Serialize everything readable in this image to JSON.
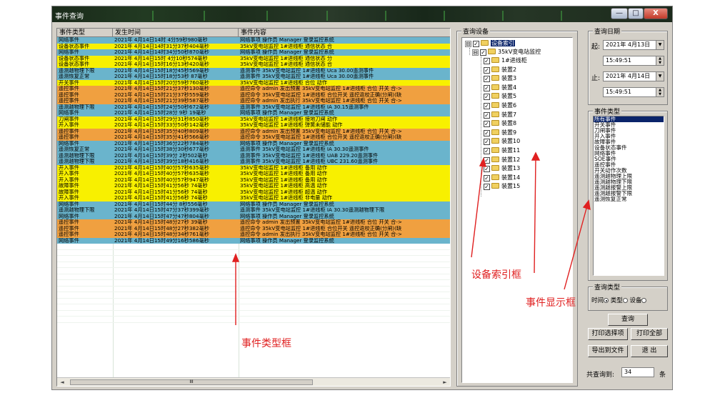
{
  "window": {
    "title": "事件查询",
    "buttons": [
      "—",
      "□",
      "X"
    ]
  },
  "table": {
    "columns": [
      "事件类型",
      "发生时间",
      "事件内容"
    ],
    "rows": [
      {
        "type": "网络事件",
        "time": "2021年 4月14日14时 4分59秒980毫秒",
        "content": "网络事项 操作员 Manager 登录监控系统",
        "color": "blue"
      },
      {
        "type": "设备状态事件",
        "time": "2021年 4月14日14时31分37秒404毫秒",
        "content": "35kV变电站监控 1#进线柜 通信状态 合",
        "color": "yellow"
      },
      {
        "type": "网络事件",
        "time": "2021年 4月14日14时34分50秒870毫秒",
        "content": "网络事项 操作员 Manager 登录监控系统",
        "color": "blue"
      },
      {
        "type": "设备状态事件",
        "time": "2021年 4月14日15时 4分10秒574毫秒",
        "content": "35kV变电站监控 1#进线柜 通信状态 分",
        "color": "yellow"
      },
      {
        "type": "设备状态事件",
        "time": "2021年 4月14日15时16分13秒420毫秒",
        "content": "35kV变电站监控 1#进线柜 通信状态 合",
        "color": "yellow"
      },
      {
        "type": "遥测越物理下限",
        "time": "2021年 4月14日15时18分45秒569毫秒",
        "content": "遥测事件 35kV变电站监控 1#进线柜 Uca 30.00遥测事件",
        "color": "blue"
      },
      {
        "type": "遥测恢复正常",
        "time": "2021年 4月14日15时18分53秒 87毫秒",
        "content": "遥测事件 35kV变电站监控 1#进线柜 Uca 30.00遥测事件",
        "color": "blue"
      },
      {
        "type": "开关事件",
        "time": "2021年 4月14日15时20分59秒760毫秒",
        "content": "35kV变电站监控 1#进线柜 合位 动作",
        "color": "yellow"
      },
      {
        "type": "遥控事件",
        "time": "2021年 4月14日15时21分37秒130毫秒",
        "content": "遥控命令 admin 发出预置 35kV变电站监控 1#进线柜 合位 开关 合->",
        "color": "orange"
      },
      {
        "type": "遥控事件",
        "time": "2021年 4月14日15时21分37秒559毫秒",
        "content": "遥控命令 35kV变电站监控 1#进线柜 合位开关 遥控返校正确(分闸)(缺",
        "color": "orange"
      },
      {
        "type": "遥控事件",
        "time": "2021年 4月14日15时21分39秒587毫秒",
        "content": "遥控命令 admin 发出执行 35kV变电站监控 1#进线柜 合位 开关 合->",
        "color": "orange"
      },
      {
        "type": "遥测越物理下限",
        "time": "2021年 4月14日15时24分50秒672毫秒",
        "content": "遥测事件 35kV变电站监控 1#进线柜 IA 30.15遥测事件",
        "color": "blue"
      },
      {
        "type": "网络事件",
        "time": "2021年 4月14日15时28分 9秒 19毫秒",
        "content": "网络事项 操作员 Manager 登录监控系统",
        "color": "blue"
      },
      {
        "type": "刀闸事件",
        "time": "2021年 4月14日15时29分31秒850毫秒",
        "content": "35kV变电站监控 1#进线柜 接地刀闸 动作",
        "color": "yellow"
      },
      {
        "type": "开入事件",
        "time": "2021年 4月14日15时33分50秒142毫秒",
        "content": "35kV变电站监控 1#进线柜 弹簧未储能 动作",
        "color": "yellow"
      },
      {
        "type": "遥控事件",
        "time": "2021年 4月14日15时35分40秒809毫秒",
        "content": "遥控命令 admin 发出预置 35kV变电站监控 1#进线柜 合位 开关 合->",
        "color": "orange"
      },
      {
        "type": "遥控事件",
        "time": "2021年 4月14日15时35分41秒566毫秒",
        "content": "遥控命令 35kV变电站监控 1#进线柜 合位开关 遥控返校正确(分闸)(缺",
        "color": "orange"
      },
      {
        "type": "网络事件",
        "time": "2021年 4月14日15时36分22秒784毫秒",
        "content": "网络事项 操作员 Manager 登录监控系统",
        "color": "blue"
      },
      {
        "type": "遥测恢复正常",
        "time": "2021年 4月14日15时38分30秒677毫秒",
        "content": "遥测事件 35kV变电站监控 1#进线柜 IA 30.30遥测事件",
        "color": "blue"
      },
      {
        "type": "遥测越物理下限",
        "time": "2021年 4月14日15时39分 2秒502毫秒",
        "content": "遥测事件 35kV变电站监控 1#进线柜 UAB 229.20遥测事件",
        "color": "blue"
      },
      {
        "type": "遥测越物理下限",
        "time": "2021年 4月14日15时39分18秒416毫秒",
        "content": "遥测事件 35kV变电站监控 1#进线柜 UBC 231.60遥测事件",
        "color": "blue"
      },
      {
        "type": "开入事件",
        "time": "2021年 4月14日15时40分57秒635毫秒",
        "content": "35kV变电站监控 1#进线柜 备用 动作",
        "color": "yellow"
      },
      {
        "type": "开入事件",
        "time": "2021年 4月14日15时40分57秒635毫秒",
        "content": "35kV变电站监控 1#进线柜 备用 动作",
        "color": "yellow"
      },
      {
        "type": "开入事件",
        "time": "2021年 4月14日15时40分57秒947毫秒",
        "content": "35kV变电站监控 1#进线柜 备用 动作",
        "color": "yellow"
      },
      {
        "type": "故障事件",
        "time": "2021年 4月14日15时41分56秒 74毫秒",
        "content": "35kV变电站监控 1#进线柜 高温 动作",
        "color": "yellow"
      },
      {
        "type": "故障事件",
        "time": "2021年 4月14日15时41分56秒 74毫秒",
        "content": "35kV变电站监控 1#进线柜 超温 动作",
        "color": "yellow"
      },
      {
        "type": "开入事件",
        "time": "2021年 4月14日15时41分56秒 74毫秒",
        "content": "35kV变电站监控 1#进线柜 非电量 动作",
        "color": "yellow"
      },
      {
        "type": "网络事件",
        "time": "2021年 4月14日15时44分 8秒556毫秒",
        "content": "网络事项 操作员 Manager 登录监控系统",
        "color": "blue"
      },
      {
        "type": "遥测越物理下限",
        "time": "2021年 4月14日15时47分37秒399毫秒",
        "content": "遥测事件 35kV变电站监控 1#进线柜 IA 30.30遥测越物理下限",
        "color": "blue"
      },
      {
        "type": "网络事件",
        "time": "2021年 4月14日15时47分47秒804毫秒",
        "content": "网络事项 操作员 Manager 登录监控系统",
        "color": "blue"
      },
      {
        "type": "遥控事件",
        "time": "2021年 4月14日15时48分27秒 39毫秒",
        "content": "遥控命令 admin 发出预置 35kV变电站监控 1#进线柜 合位 开关 合->",
        "color": "orange"
      },
      {
        "type": "遥控事件",
        "time": "2021年 4月14日15时48分27秒382毫秒",
        "content": "遥控命令 35kV变电站监控 1#进线柜 合位开关 遥控返校正确(分闸)(缺",
        "color": "orange"
      },
      {
        "type": "遥控事件",
        "time": "2021年 4月14日15时48分34秒761毫秒",
        "content": "遥控命令 admin 发出执行 35kV变电站监控 1#进线柜 合位 开关 合->",
        "color": "orange"
      },
      {
        "type": "网络事件",
        "time": "2021年 4月14日15时49分16秒586毫秒",
        "content": "网络事项 操作员 Manager 登录监控系统",
        "color": "blue"
      }
    ],
    "empty_rows": 13,
    "hscroll_thumb": "III"
  },
  "device_panel": {
    "label": "查询设备",
    "root": "设备索引",
    "station": "35kV变电站监控",
    "devices": [
      "1#进线柜",
      "装置2",
      "装置3",
      "装置4",
      "装置5",
      "装置6",
      "装置7",
      "装置8",
      "装置9",
      "装置10",
      "装置11",
      "装置12",
      "装置13",
      "装置14",
      "装置15"
    ],
    "expander": "⊟"
  },
  "date_panel": {
    "label": "查询日期",
    "start_label": "起:",
    "start_date": "2021年 4月13日",
    "start_time": "15:49:51",
    "end_label": "止:",
    "end_date": "2021年 4月14日",
    "end_time": "15:49:51"
  },
  "event_type_panel": {
    "label": "事件类型",
    "items": [
      "所有事件",
      "开关事件",
      "刀闸事件",
      "开入事件",
      "故障事件",
      "设备状态事件",
      "网络事件",
      "SOE事件",
      "遥控事件",
      "开关动作次数",
      "遥测越物理上限",
      "遥测越物理下限",
      "遥测越报警上限",
      "遥测越报警下限",
      "遥测恢复正常"
    ],
    "selected": 0
  },
  "query_type_panel": {
    "label": "查询类型",
    "options": [
      "时间",
      "类型",
      "设备"
    ],
    "selected": 0
  },
  "buttons": {
    "query": "查询",
    "print_selected": "打印选择项",
    "print_all": "打印全部",
    "export": "导出到文件",
    "exit": "退 出"
  },
  "total": {
    "label": "共查询到:",
    "count": "34",
    "unit": "条"
  },
  "annotations": {
    "event_type_box": "事件类型框",
    "device_index_box": "设备索引框",
    "event_display_box": "事件显示框"
  },
  "colors": {
    "row_blue": "#6ab4cc",
    "row_yellow": "#f8f000",
    "row_orange": "#f0a040",
    "selection": "#0a246a",
    "annotation": "#e02020"
  }
}
